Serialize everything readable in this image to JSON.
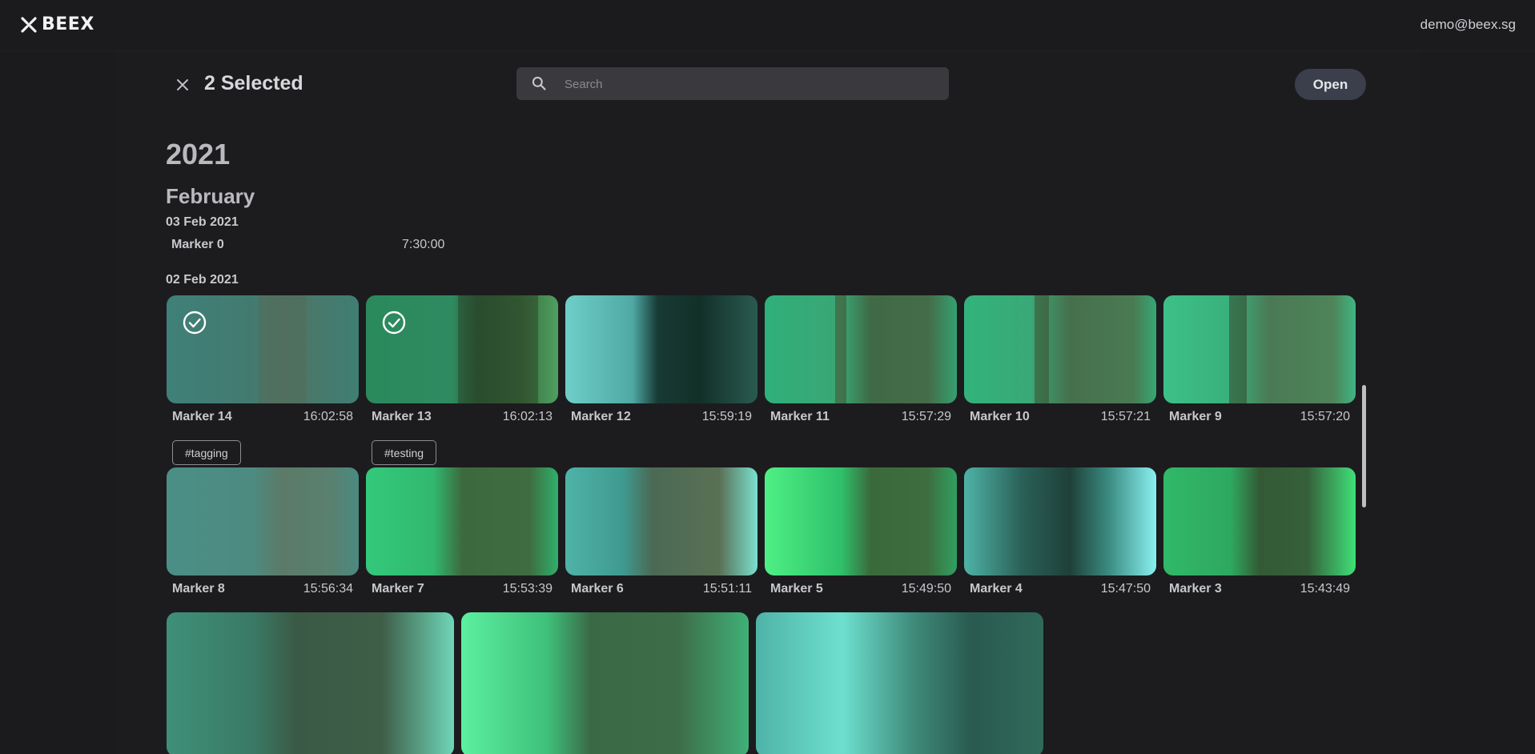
{
  "app": {
    "brand": "BEEX",
    "user_email": "demo@beex.sg"
  },
  "toolbar": {
    "selected_label": "2 Selected",
    "search_placeholder": "Search",
    "search_value": "",
    "open_label": "Open"
  },
  "timeline": {
    "year": "2021",
    "month": "February",
    "days": [
      {
        "date": "03 Feb 2021",
        "markers": [
          {
            "name": "Marker 0",
            "time": "7:30:00"
          }
        ]
      },
      {
        "date": "02 Feb 2021",
        "markers": [
          {
            "name": "Marker 14",
            "time": "16:02:58",
            "tag": "#tagging",
            "selected": true
          },
          {
            "name": "Marker 13",
            "time": "16:02:13",
            "tag": "#testing",
            "selected": true
          },
          {
            "name": "Marker 12",
            "time": "15:59:19"
          },
          {
            "name": "Marker 11",
            "time": "15:57:29"
          },
          {
            "name": "Marker 10",
            "time": "15:57:21"
          },
          {
            "name": "Marker 9",
            "time": "15:57:20"
          },
          {
            "name": "Marker 8",
            "time": "15:56:34"
          },
          {
            "name": "Marker 7",
            "time": "15:53:39"
          },
          {
            "name": "Marker 6",
            "time": "15:51:11"
          },
          {
            "name": "Marker 5",
            "time": "15:49:50"
          },
          {
            "name": "Marker 4",
            "time": "15:47:50"
          },
          {
            "name": "Marker 3",
            "time": "15:43:49"
          }
        ]
      }
    ]
  },
  "colors": {
    "background": "#1b1b1e",
    "accent_button": "#3a3f4b",
    "search_bg": "#3a3a3e"
  }
}
